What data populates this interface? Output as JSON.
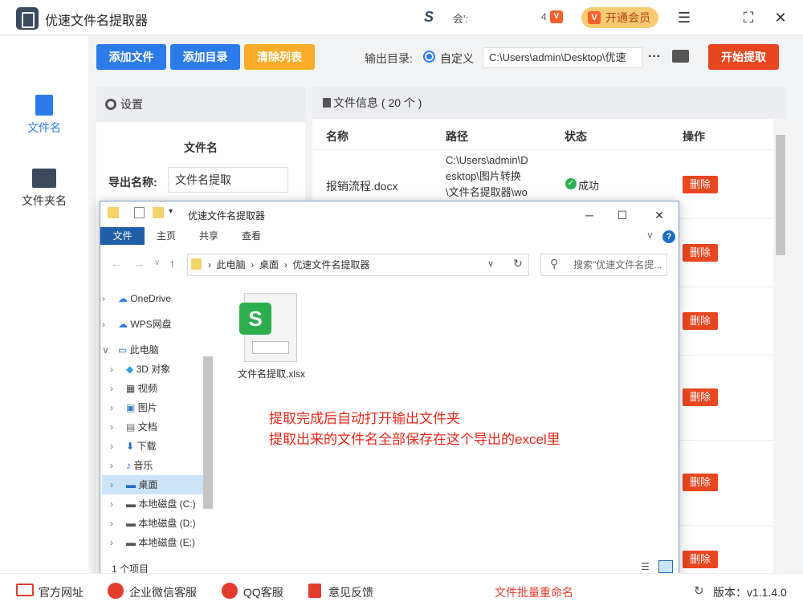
{
  "app": {
    "title": "优速文件名提取器",
    "user_text": "会':",
    "count": "4",
    "vip_label": "开通会员"
  },
  "sidebar": {
    "items": [
      {
        "label": "文件名",
        "active": true
      },
      {
        "label": "文件夹名",
        "active": false
      }
    ]
  },
  "toolbar": {
    "add_file": "添加文件",
    "add_dir": "添加目录",
    "clear_list": "清除列表",
    "output_label": "输出目录:",
    "radio_label": "自定义",
    "output_path": "C:\\Users\\admin\\Desktop\\优速",
    "more": "···",
    "start": "开始提取"
  },
  "settings": {
    "header": "设置",
    "section": "文件名",
    "export_label": "导出名称:",
    "export_value": "文件名提取"
  },
  "fileinfo": {
    "header": "文件信息 ( 20 个 )",
    "columns": [
      "名称",
      "路径",
      "状态",
      "操作"
    ],
    "row1": {
      "name": "报销流程.docx",
      "path1": "C:\\Users\\admin\\D",
      "path2": "esktop\\图片转换",
      "path3": "\\文件名提取器\\wo",
      "status": "成功"
    },
    "delete_label": "删除"
  },
  "explorer": {
    "title": "优速文件名提取器",
    "tabs": [
      "文件",
      "主页",
      "共享",
      "查看"
    ],
    "breadcrumb": [
      "此电脑",
      "桌面",
      "优速文件名提取器"
    ],
    "search_placeholder": "搜索\"优速文件名提...",
    "tree": [
      "OneDrive",
      "WPS网盘",
      "此电脑",
      "3D 对象",
      "视频",
      "图片",
      "文档",
      "下载",
      "音乐",
      "桌面",
      "本地磁盘 (C:)",
      "本地磁盘 (D:)",
      "本地磁盘 (E:)"
    ],
    "file_name": "文件名提取.xlsx",
    "status": "1 个项目"
  },
  "annotation": {
    "line1": "提取完成后自动打开输出文件夹",
    "line2": "提取出来的文件名全部保存在这个导出的excel里"
  },
  "bottom": {
    "site": "官方网址",
    "wechat": "企业微信客服",
    "qq": "QQ客服",
    "feedback": "意见反馈",
    "batch": "文件批量重命名",
    "version": "版本：v1.1.4.0"
  },
  "colors": {
    "blue": "#2b7ce9",
    "orange": "#fbad2a",
    "red": "#e8461f"
  }
}
